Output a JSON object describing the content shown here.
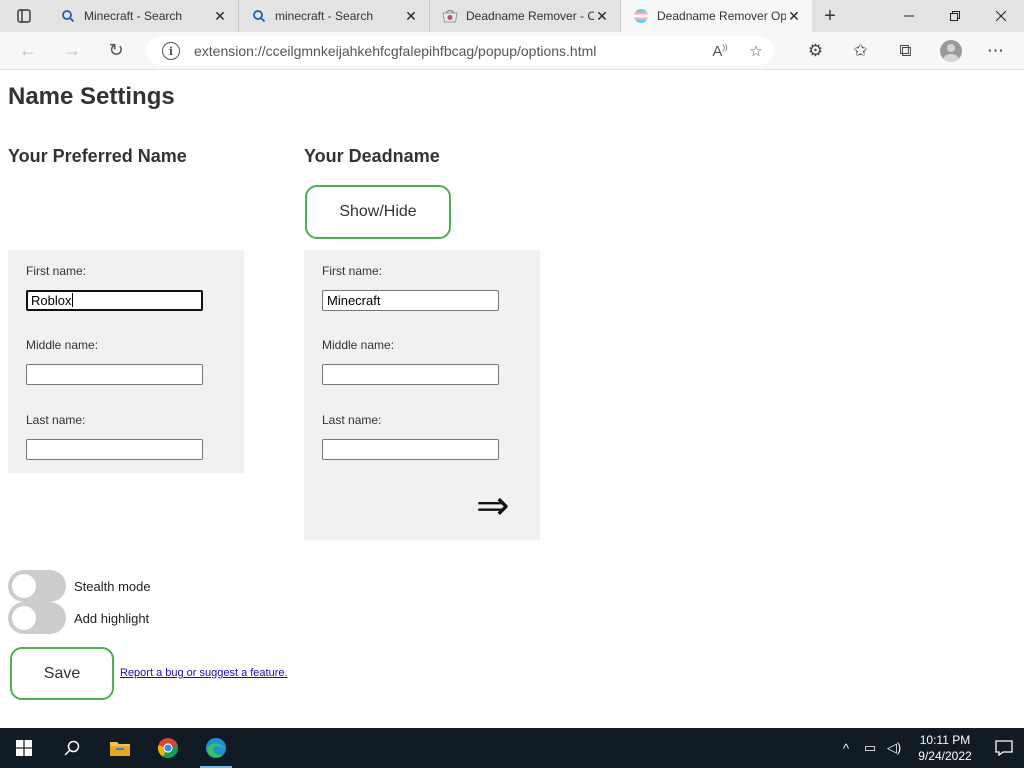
{
  "browser": {
    "tabs": [
      {
        "title": "Minecraft - Search",
        "icon": "search-icon"
      },
      {
        "title": "minecraft - Search",
        "icon": "search-icon"
      },
      {
        "title": "Deadname Remover - C",
        "icon": "chrome-webstore-icon"
      },
      {
        "title": "Deadname Remover Op",
        "icon": "trans-flag-icon",
        "active": true
      }
    ],
    "url": "extension://cceilgmnkeijahkehfcgfalepihfbcag/popup/options.html"
  },
  "page": {
    "title": "Name Settings",
    "preferred": {
      "heading": "Your Preferred Name",
      "first_label": "First name:",
      "first_value": "Roblox",
      "middle_label": "Middle name:",
      "middle_value": "",
      "last_label": "Last name:",
      "last_value": ""
    },
    "deadname": {
      "heading": "Your Deadname",
      "show_hide_label": "Show/Hide",
      "first_label": "First name:",
      "first_value": "Minecraft",
      "middle_label": "Middle name:",
      "middle_value": "",
      "last_label": "Last name:",
      "last_value": ""
    },
    "arrow_glyph": "⇒",
    "options": {
      "stealth_label": "Stealth mode",
      "stealth_on": false,
      "highlight_label": "Add highlight",
      "highlight_on": false
    },
    "save_label": "Save",
    "report_link": "Report a bug or suggest a feature."
  },
  "taskbar": {
    "time": "10:11 PM",
    "date": "9/24/2022"
  },
  "colors": {
    "accent_green": "#4caf50",
    "panel_bg": "#f1f1f1",
    "toggle_off": "#cccccc",
    "taskbar_bg": "#101b24"
  }
}
